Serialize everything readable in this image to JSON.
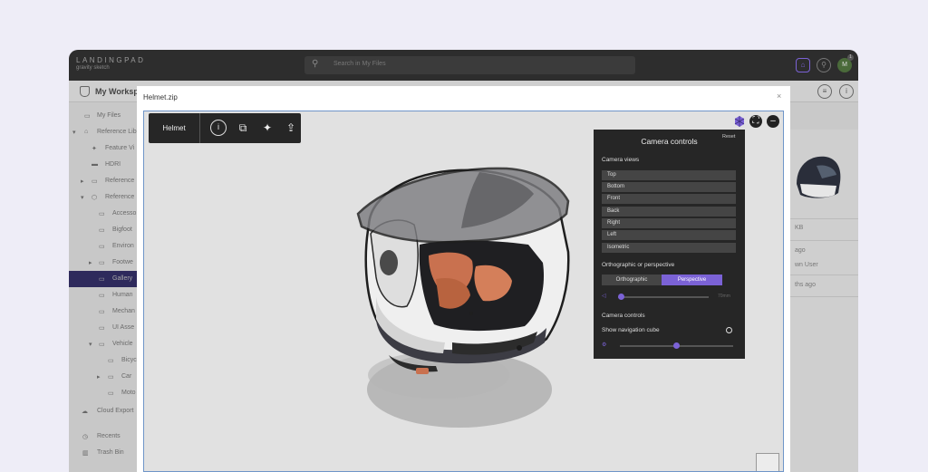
{
  "brand": {
    "name": "LANDINGPAD",
    "sub": "gravity sketch"
  },
  "search": {
    "placeholder": "Search in My Files"
  },
  "topbar": {
    "avatar_initial": "M",
    "notification_count": "1"
  },
  "workspace": {
    "name": "My Workspace"
  },
  "sidebar": {
    "items": [
      {
        "label": "My Files",
        "icon": "file-icon"
      },
      {
        "label": "Reference Lib",
        "icon": "library-icon"
      },
      {
        "label": "Feature Vi",
        "icon": "run-icon"
      },
      {
        "label": "HDRI",
        "icon": "image-icon"
      },
      {
        "label": "Reference",
        "icon": "box-icon"
      },
      {
        "label": "Reference",
        "icon": "cube-icon"
      },
      {
        "label": "Accesso",
        "icon": "folder-icon"
      },
      {
        "label": "Bigfoot",
        "icon": "folder-icon"
      },
      {
        "label": "Environ",
        "icon": "folder-icon"
      },
      {
        "label": "Footwe",
        "icon": "folder-icon"
      },
      {
        "label": "Gallery",
        "icon": "folder-icon"
      },
      {
        "label": "Human",
        "icon": "folder-icon"
      },
      {
        "label": "Mechan",
        "icon": "folder-icon"
      },
      {
        "label": "UI Asse",
        "icon": "folder-icon"
      },
      {
        "label": "Vehicle",
        "icon": "folder-icon"
      },
      {
        "label": "Bicyc",
        "icon": "folder-icon"
      },
      {
        "label": "Car",
        "icon": "folder-icon"
      },
      {
        "label": "Moto",
        "icon": "folder-icon"
      },
      {
        "label": "Cloud Export",
        "icon": "cloud-icon"
      },
      {
        "label": "Recents",
        "icon": "clock-icon"
      },
      {
        "label": "Trash Bin",
        "icon": "trash-icon"
      }
    ]
  },
  "right_panel": {
    "size": "KB",
    "modified": "ago",
    "owner": "wn User",
    "created": "ths ago"
  },
  "modal": {
    "title": "Helmet.zip",
    "close": "×"
  },
  "toolbar": {
    "model_name": "Helmet"
  },
  "camera_panel": {
    "title": "Camera controls",
    "reset": "Reset",
    "views_label": "Camera views",
    "views": [
      "Top",
      "Bottom",
      "Front",
      "Back",
      "Right",
      "Left",
      "Isometric"
    ],
    "projection_label": "Orthographic or perspective",
    "projection_options": [
      "Orthographic",
      "Perspective"
    ],
    "projection_selected": "Perspective",
    "fov_value": "70mm",
    "controls_label": "Camera controls",
    "show_nav_cube_label": "Show navigation cube",
    "fov_slider_level": 0.03,
    "speed_slider_level": 0.5
  },
  "colors": {
    "accent": "#7b62d6",
    "panel": "#262626",
    "selection": "#2e2a5c"
  }
}
